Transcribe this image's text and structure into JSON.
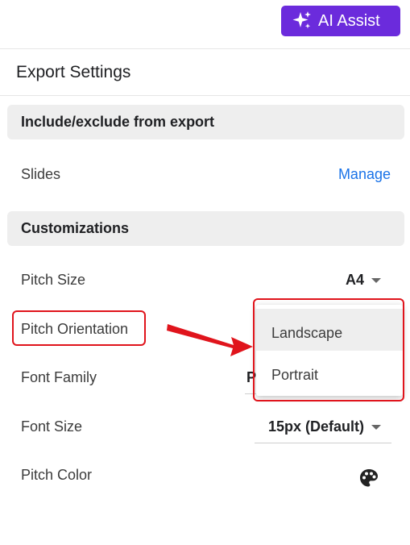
{
  "header": {
    "ai_assist_label": "AI Assist",
    "ai_icon": "sparkles-icon"
  },
  "panel": {
    "title": "Export Settings"
  },
  "sections": {
    "include": {
      "title": "Include/exclude from export",
      "slides_label": "Slides",
      "manage_link": "Manage"
    },
    "customizations": {
      "title": "Customizations",
      "pitch_size_label": "Pitch Size",
      "pitch_size_value": "A4",
      "pitch_orientation_label": "Pitch Orientation",
      "font_family_label": "Font Family",
      "font_family_value_partial": "P",
      "font_size_label": "Font Size",
      "font_size_value": "15px (Default)",
      "pitch_color_label": "Pitch Color",
      "pitch_color_icon": "palette-icon"
    }
  },
  "orientation_dropdown": {
    "options": [
      "Landscape",
      "Portrait"
    ],
    "hovered": "Landscape"
  },
  "colors": {
    "accent_purple": "#6b2bdc",
    "link_blue": "#1a73e8",
    "annotation_red": "#e0141c"
  }
}
